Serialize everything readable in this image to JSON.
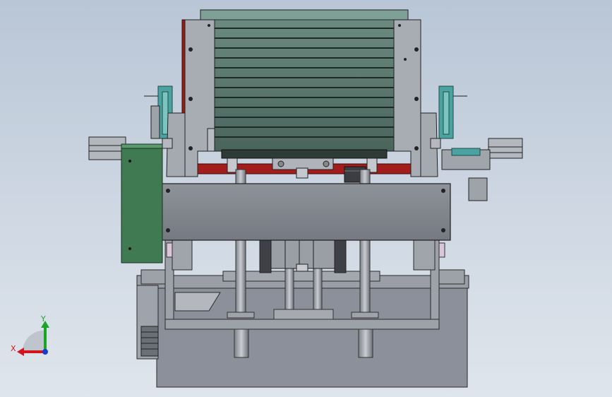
{
  "viewport": {
    "background_top": "#b9c6d6",
    "background_bottom": "#dfe5ec"
  },
  "triad": {
    "x_label": "X",
    "y_label": "Y",
    "x_color": "#d4141a",
    "y_color": "#1aa52a",
    "z_color": "#1a3ad4"
  },
  "model": {
    "frame_color": "#8a8f98",
    "cover_color": "#7b7f86",
    "fin_color": "#4f6b63",
    "motor_color": "#3f7a53",
    "accent_color": "#a31d1d",
    "teal_color": "#4aa3a0"
  }
}
